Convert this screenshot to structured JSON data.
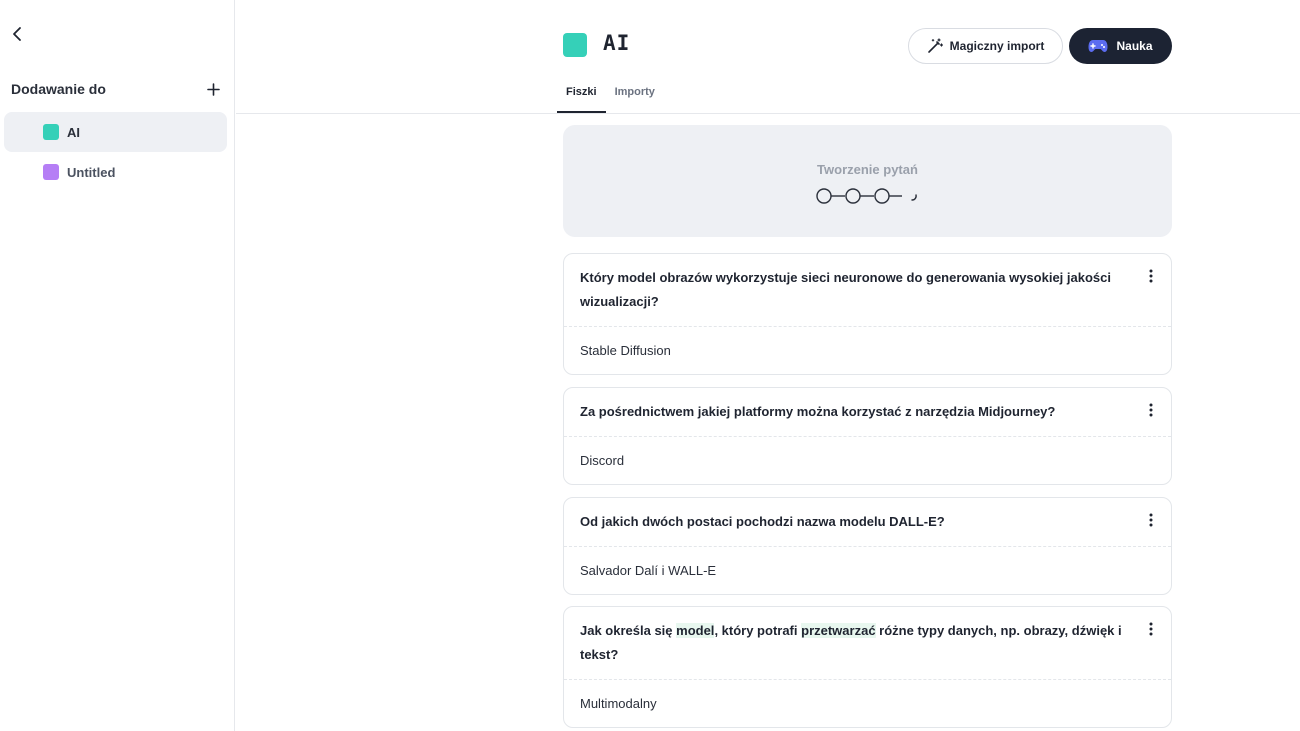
{
  "sidebar": {
    "title": "Dodawanie do",
    "decks": [
      {
        "label": "AI",
        "color": "#35d0b8",
        "active": true
      },
      {
        "label": "Untitled",
        "color": "#b57ef5",
        "active": false
      }
    ]
  },
  "header": {
    "deck_title": "AI",
    "deck_color": "#35d0b8",
    "import_label": "Magiczny import",
    "study_label": "Nauka",
    "tabs": [
      {
        "label": "Fiszki",
        "active": true
      },
      {
        "label": "Importy",
        "active": false
      }
    ]
  },
  "generating": {
    "label": "Tworzenie pytań",
    "steps_done": 3
  },
  "cards": [
    {
      "question": "Który model obrazów wykorzystuje sieci neuronowe do generowania wysokiej jakości wizualizacji?",
      "answer": "Stable Diffusion"
    },
    {
      "question": "Za pośrednictwem jakiej platformy można korzystać z narzędzia Midjourney?",
      "answer": "Discord"
    },
    {
      "question": "Od jakich dwóch postaci pochodzi nazwa modelu DALL-E?",
      "answer": "Salvador Dalí i WALL-E"
    },
    {
      "question_parts": [
        "Jak określa się ",
        "model",
        ", który potrafi ",
        "przetwarzać",
        " różne typy danych, np. obrazy, dźwięk i tekst?"
      ],
      "answer": "Multimodalny"
    }
  ],
  "colors": {
    "accent_dark": "#1c2333",
    "study_icon": "#5b6cf0"
  }
}
